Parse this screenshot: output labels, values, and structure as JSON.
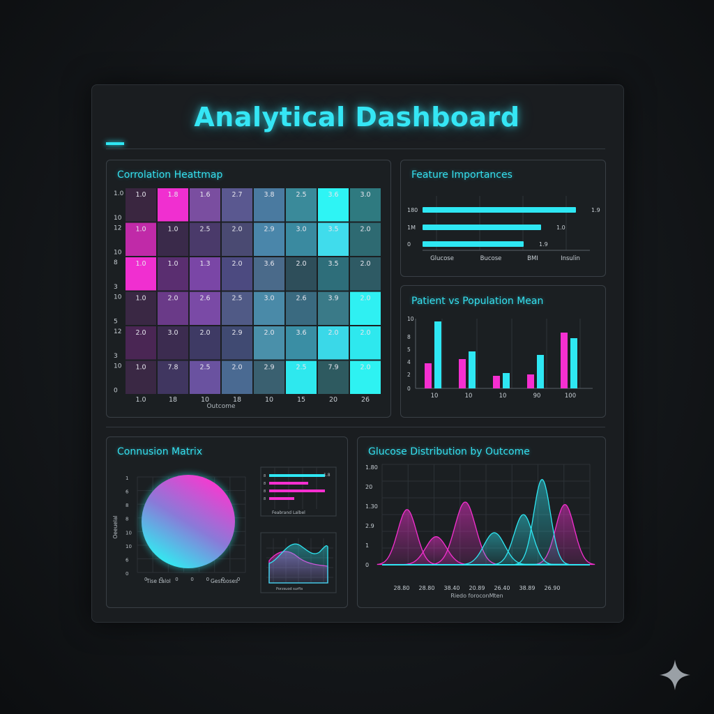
{
  "title": "Analytical Dashboard",
  "colors": {
    "accent": "#2ee7f3",
    "magenta": "#f52fd0",
    "panel_border": "#3a4046"
  },
  "panels": {
    "heatmap": {
      "title": "Corrolation Heattmap"
    },
    "importance": {
      "title": "Feature Importances"
    },
    "patient": {
      "title": "Patient vs Population Mean"
    },
    "confusion": {
      "title": "Connusion Matrix"
    },
    "glucose": {
      "title": "Glucose Distribution by Outcome"
    }
  },
  "watermark_icon": "sparkle-icon",
  "chart_data": [
    {
      "id": "heatmap",
      "type": "heatmap",
      "title": "Corrolation Heattmap",
      "row_labels": [
        [
          "1.0",
          "10"
        ],
        [
          "12",
          "10"
        ],
        [
          "8",
          "3"
        ],
        [
          "10",
          "5"
        ],
        [
          "12",
          "3"
        ],
        [
          "10",
          "0"
        ]
      ],
      "col_labels": [
        "1.0",
        "18",
        "10",
        "18",
        "10",
        "15",
        "20",
        "26"
      ],
      "xlabel": "Outcome",
      "cells": [
        [
          "1.0",
          "1.8",
          "1.6",
          "2.7",
          "3.8",
          "2.5",
          "3.6",
          "3.0"
        ],
        [
          "1.0",
          "1.0",
          "2.5",
          "2.0",
          "2.9",
          "3.0",
          "3.5",
          "2.0"
        ],
        [
          "1.0",
          "1.0",
          "1.3",
          "2.0",
          "3.6",
          "2.0",
          "3.5",
          "2.0"
        ],
        [
          "1.0",
          "2.0",
          "2.6",
          "2.5",
          "3.0",
          "2.6",
          "3.9",
          "2.0"
        ],
        [
          "2.0",
          "3.0",
          "2.0",
          "2.9",
          "2.0",
          "3.6",
          "2.0",
          "2.0"
        ],
        [
          "1.0",
          "7.8",
          "2.5",
          "2.0",
          "2.9",
          "2.5",
          "7.9",
          "2.0"
        ]
      ],
      "colors": [
        [
          "#3a2640",
          "#f02fd0",
          "#7a4ea0",
          "#5a5890",
          "#4a7aa0",
          "#3a8a9a",
          "#2ef4f4",
          "#2f7a80"
        ],
        [
          "#c02aa8",
          "#3a2a4a",
          "#4a3a6a",
          "#4a4a72",
          "#4a86aa",
          "#3a8aa0",
          "#40dcec",
          "#2e6a72"
        ],
        [
          "#f02fd0",
          "#5a2e70",
          "#7a46a6",
          "#4c4a80",
          "#4a6a8a",
          "#2e4e5a",
          "#2e6e7a",
          "#2e5a64"
        ],
        [
          "#3a2844",
          "#6a3a88",
          "#7a4aa6",
          "#505a86",
          "#4a8aa8",
          "#3a6a80",
          "#3a7a88",
          "#2ff0f2"
        ],
        [
          "#4a2654",
          "#3c2c50",
          "#3e3a64",
          "#404a72",
          "#4a90aa",
          "#3a8ea4",
          "#3ad8e8",
          "#2ee8ee"
        ],
        [
          "#3a2844",
          "#403660",
          "#6a52a0",
          "#4a6a92",
          "#3a6070",
          "#2ee8ee",
          "#2e5a60",
          "#2ef2f2"
        ]
      ]
    },
    {
      "id": "importance",
      "type": "bar",
      "title": "Feature Importances",
      "orientation": "horizontal",
      "y_ticks": [
        "180",
        "1M",
        "0"
      ],
      "x_ticks": [
        "Glucose",
        "Bucose",
        "BMI",
        "Insulin"
      ],
      "values": [
        0.88,
        0.68,
        0.58
      ],
      "value_labels": [
        "1.9",
        "1.0",
        "1.9"
      ],
      "xlim": [
        0,
        1
      ]
    },
    {
      "id": "patient",
      "type": "bar",
      "title": "Patient vs Population Mean",
      "categories": [
        "10",
        "10",
        "10",
        "90",
        "100"
      ],
      "y_ticks": [
        "10",
        "8",
        "5",
        "4",
        "2",
        "0"
      ],
      "ylim": [
        0,
        10
      ],
      "series": [
        {
          "color": "#f52fd0",
          "values": [
            3.6,
            4.2,
            1.8,
            2.0,
            8.0
          ]
        },
        {
          "color": "#2ee7f3",
          "values": [
            9.6,
            5.3,
            2.2,
            4.8,
            7.2
          ]
        }
      ]
    },
    {
      "id": "confusion",
      "type": "scatter",
      "title": "Connusion Matrix",
      "y_ticks": [
        "1",
        "6",
        "8",
        "8",
        "10",
        "10",
        "6",
        "0"
      ],
      "x_ticks": [
        "0",
        "0",
        "0",
        "0",
        "0",
        "0",
        "0"
      ],
      "ylabel": "Oeeuelal",
      "xlabel_left": "Tise Lalol",
      "xlabel_right": "Gestuoses",
      "inset_bars": {
        "labels": [
          "8",
          "8",
          "8",
          "8"
        ],
        "values": [
          1.0,
          0.7,
          1.0,
          0.45
        ],
        "colors": [
          "#2ee7f3",
          "#f52fd0",
          "#f52fd0",
          "#f52fd0"
        ],
        "value_label": "1.8",
        "xlabel": "Feabrand Lalbel"
      },
      "inset_area": {
        "xlabel": "Porzsuod surfts"
      }
    },
    {
      "id": "glucose",
      "type": "area",
      "title": "Glucose Distribution by Outcome",
      "y_ticks": [
        "1.80",
        "20",
        "1.30",
        "2.9",
        "1",
        "0"
      ],
      "x_ticks": [
        "28.80",
        "28.80",
        "38.40",
        "20.89",
        "26.40",
        "38.89",
        "26.90"
      ],
      "xlabel": "Riedo foroconMten",
      "ylim": [
        0,
        2
      ],
      "series": [
        {
          "color": "#f52fd0",
          "peaks": [
            [
              0.12,
              1.1,
              0.045
            ],
            [
              0.26,
              0.56,
              0.05
            ],
            [
              0.4,
              1.25,
              0.05
            ],
            [
              0.88,
              1.2,
              0.045
            ]
          ]
        },
        {
          "color": "#2ee7f3",
          "peaks": [
            [
              0.54,
              0.64,
              0.05
            ],
            [
              0.68,
              1.0,
              0.045
            ],
            [
              0.77,
              1.7,
              0.04
            ]
          ]
        }
      ]
    }
  ]
}
